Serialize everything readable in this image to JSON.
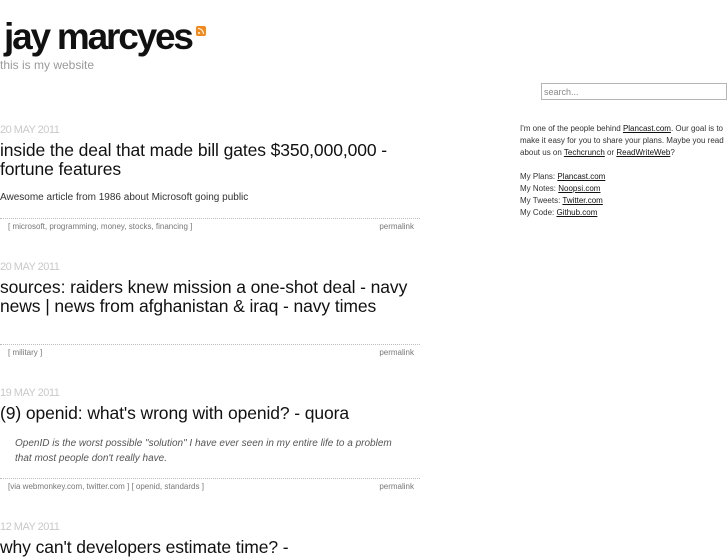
{
  "header": {
    "title": "jay marcyes",
    "tagline": "this is my website"
  },
  "search": {
    "placeholder": "search..."
  },
  "posts": [
    {
      "date": "20 MAY 2011",
      "title": "inside the deal that made bill gates $350,000,000 - fortune features",
      "body": "Awesome article from 1986 about Microsoft going public",
      "tags": "[ microsoft, programming, money, stocks, financing ]",
      "permalink": "permalink"
    },
    {
      "date": "20 MAY 2011",
      "title": "sources: raiders knew mission a one-shot deal - navy news | news from afghanistan & iraq - navy times",
      "tags": "[ military ]",
      "permalink": "permalink"
    },
    {
      "date": "19 MAY 2011",
      "title": "(9) openid: what's wrong with openid? - quora",
      "quote": "OpenID is the worst possible \"solution\" I have ever seen in my entire life to a problem that most people don't really have.",
      "tags": "[via webmonkey.com, twitter.com ] [ openid, standards ]",
      "permalink": "permalink"
    },
    {
      "date": "12 MAY 2011",
      "title": "why can't developers estimate time? -"
    }
  ],
  "sidebar": {
    "intro_1": "I'm one of the people behind ",
    "intro_link_plancast": "Plancast.com",
    "intro_2": ". Our goal is to make it easy for you to share your plans. Maybe you read about us on ",
    "intro_link_techcrunch": "Techcrunch",
    "intro_3": " or ",
    "intro_link_rww": "ReadWriteWeb",
    "intro_4": "?",
    "links": [
      {
        "label": "My Plans: ",
        "link": "Plancast.com"
      },
      {
        "label": "My Notes: ",
        "link": "Noopsi.com"
      },
      {
        "label": "My Tweets: ",
        "link": "Twitter.com"
      },
      {
        "label": "My Code: ",
        "link": "Github.com"
      }
    ]
  }
}
